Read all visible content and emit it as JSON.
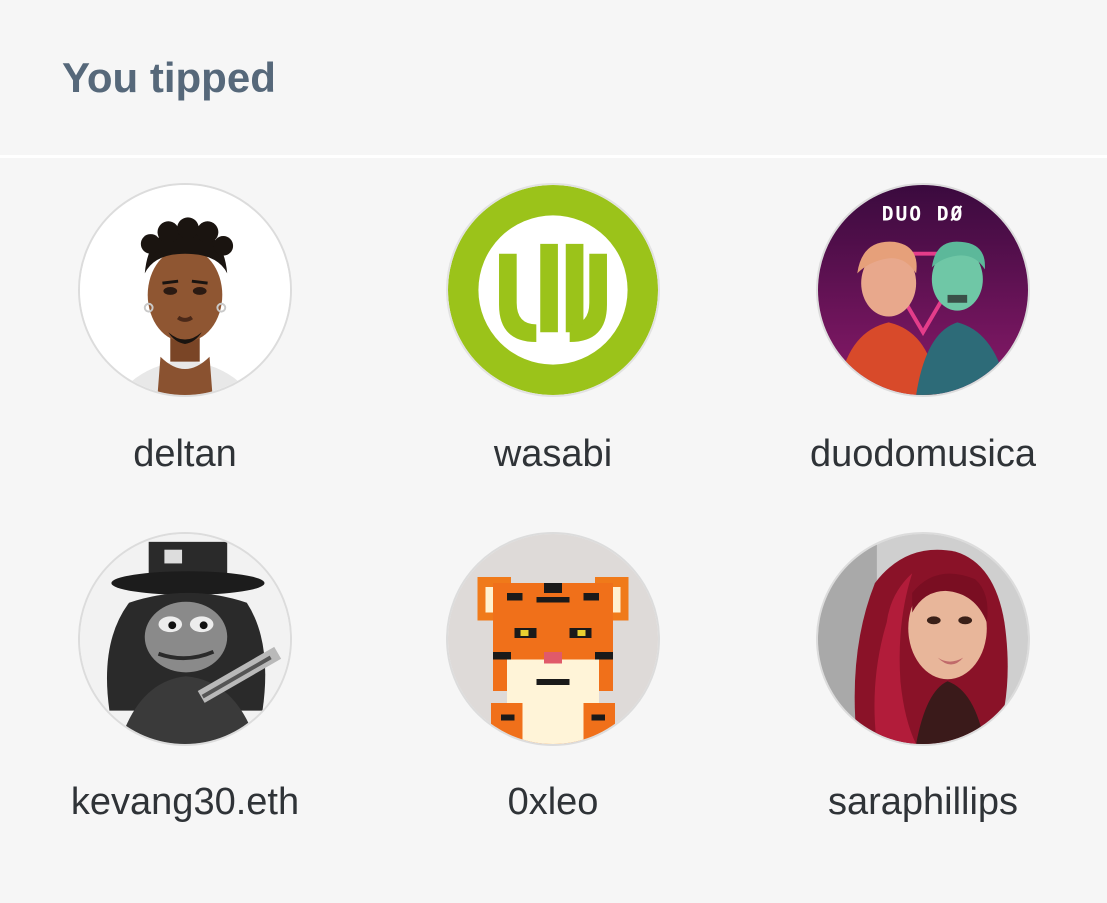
{
  "section": {
    "title": "You tipped"
  },
  "users": [
    {
      "name": "deltan",
      "avatar_icon": "cartoon-man-avatar-icon"
    },
    {
      "name": "wasabi",
      "avatar_icon": "wasabi-logo-icon",
      "accent": "#9bc31a"
    },
    {
      "name": "duodomusica",
      "avatar_icon": "duo-do-album-avatar-icon",
      "avatar_text": "DUO DØ"
    },
    {
      "name": "kevang30.eth",
      "avatar_icon": "frog-rocker-avatar-icon"
    },
    {
      "name": "0xleo",
      "avatar_icon": "pixel-tiger-avatar-icon"
    },
    {
      "name": "saraphillips",
      "avatar_icon": "red-hair-woman-avatar-icon"
    }
  ]
}
